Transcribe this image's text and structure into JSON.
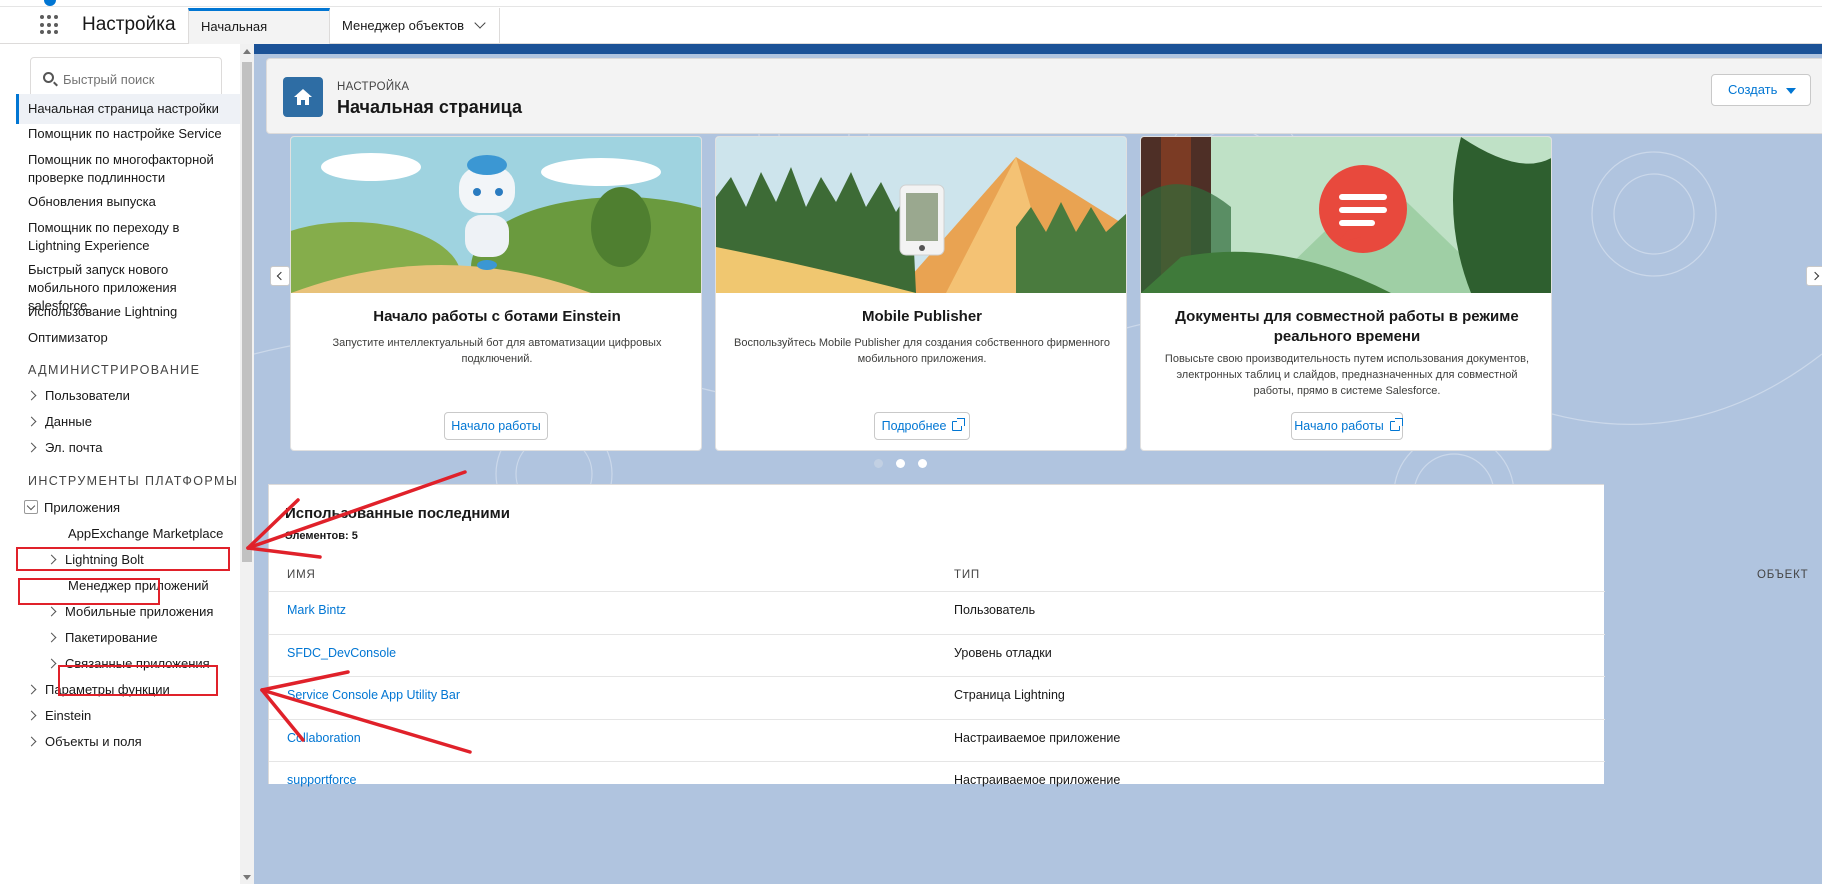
{
  "topbar": {
    "app_name": "Настройка",
    "tabs": [
      {
        "label": "Начальная страница"
      },
      {
        "label": "Менеджер объектов"
      }
    ]
  },
  "sidebar": {
    "search_placeholder": "Быстрый поиск",
    "items": [
      "Начальная страница настройки",
      "Помощник по настройке Service",
      "Помощник по многофакторной проверке подлинности",
      "Обновления выпуска",
      "Помощник по переходу в Lightning Experience",
      "Быстрый запуск нового мобильного приложения salesforce",
      "Использование Lightning",
      "Оптимизатор"
    ],
    "admin_heading": "АДМИНИСТРИРОВАНИЕ",
    "admin_items": [
      "Пользователи",
      "Данные",
      "Эл. почта"
    ],
    "platform_heading": "ИНСТРУМЕНТЫ ПЛАТФОРМЫ",
    "apps_label": "Приложения",
    "apps_children": [
      "AppExchange Marketplace",
      "Lightning Bolt",
      "Менеджер приложений",
      "Мобильные приложения",
      "Пакетирование",
      "Связанные приложения"
    ],
    "more_items": [
      "Параметры функции",
      "Einstein",
      "Объекты и поля"
    ]
  },
  "header": {
    "kicker": "НАСТРОЙКА",
    "title": "Начальная страница",
    "create_label": "Создать"
  },
  "cards": [
    {
      "title": "Начало работы с ботами Einstein",
      "desc": "Запустите интеллектуальный бот для автоматизации цифровых подключений.",
      "button": "Начало работы"
    },
    {
      "title": "Mobile Publisher",
      "desc": "Воспользуйтесь Mobile Publisher для создания собственного фирменного мобильного приложения.",
      "button": "Подробнее"
    },
    {
      "title": "Документы для совместной работы в режиме реального времени",
      "desc": "Повысьте свою производительность путем использования документов, электронных таблиц и слайдов, предназначенных для совместной работы, прямо в системе Salesforce.",
      "button": "Начало работы"
    }
  ],
  "recent": {
    "title": "Использованные последними",
    "count": "Элементов: 5",
    "columns": [
      "ИМЯ",
      "ТИП",
      "ОБЪЕКТ"
    ],
    "rows": [
      {
        "name": "Mark Bintz",
        "type": "Пользователь"
      },
      {
        "name": "SFDC_DevConsole",
        "type": "Уровень отладки"
      },
      {
        "name": "Service Console App Utility Bar",
        "type": "Страница Lightning"
      },
      {
        "name": "Collaboration",
        "type": "Настраиваемое приложение"
      },
      {
        "name": "supportforce",
        "type": "Настраиваемое приложение"
      }
    ]
  },
  "colors": {
    "accent": "#0176d3",
    "annotation": "#e0212a"
  }
}
